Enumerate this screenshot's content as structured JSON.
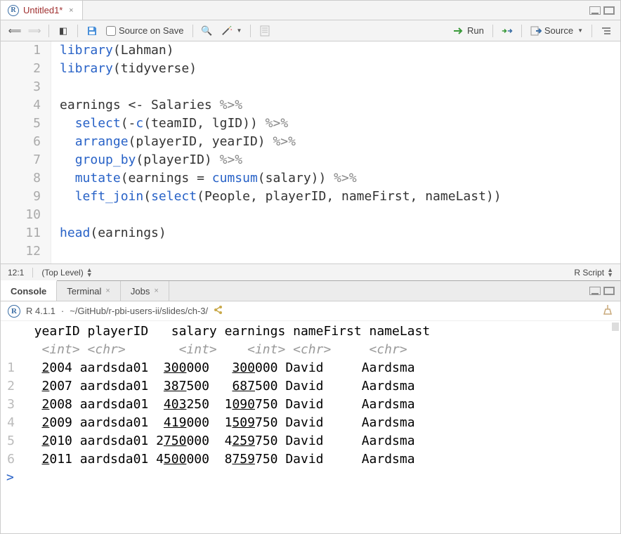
{
  "tab": {
    "title": "Untitled1*"
  },
  "toolbar": {
    "source_on_save": "Source on Save",
    "run": "Run",
    "source": "Source"
  },
  "editor": {
    "lines": [
      {
        "n": 1,
        "tokens": [
          {
            "t": "library",
            "c": "fn"
          },
          {
            "t": "(Lahman)",
            "c": ""
          }
        ]
      },
      {
        "n": 2,
        "tokens": [
          {
            "t": "library",
            "c": "fn"
          },
          {
            "t": "(tidyverse)",
            "c": ""
          }
        ]
      },
      {
        "n": 3,
        "tokens": []
      },
      {
        "n": 4,
        "tokens": [
          {
            "t": "earnings <- Salaries ",
            "c": ""
          },
          {
            "t": "%>%",
            "c": "op"
          }
        ]
      },
      {
        "n": 5,
        "tokens": [
          {
            "t": "  ",
            "c": ""
          },
          {
            "t": "select",
            "c": "fn"
          },
          {
            "t": "(-",
            "c": ""
          },
          {
            "t": "c",
            "c": "fn"
          },
          {
            "t": "(teamID, lgID)) ",
            "c": ""
          },
          {
            "t": "%>%",
            "c": "op"
          }
        ]
      },
      {
        "n": 6,
        "tokens": [
          {
            "t": "  ",
            "c": ""
          },
          {
            "t": "arrange",
            "c": "fn"
          },
          {
            "t": "(playerID, yearID) ",
            "c": ""
          },
          {
            "t": "%>%",
            "c": "op"
          }
        ]
      },
      {
        "n": 7,
        "tokens": [
          {
            "t": "  ",
            "c": ""
          },
          {
            "t": "group_by",
            "c": "fn"
          },
          {
            "t": "(playerID) ",
            "c": ""
          },
          {
            "t": "%>%",
            "c": "op"
          }
        ]
      },
      {
        "n": 8,
        "tokens": [
          {
            "t": "  ",
            "c": ""
          },
          {
            "t": "mutate",
            "c": "fn"
          },
          {
            "t": "(earnings = ",
            "c": ""
          },
          {
            "t": "cumsum",
            "c": "fn"
          },
          {
            "t": "(salary)) ",
            "c": ""
          },
          {
            "t": "%>%",
            "c": "op"
          }
        ]
      },
      {
        "n": 9,
        "tokens": [
          {
            "t": "  ",
            "c": ""
          },
          {
            "t": "left_join",
            "c": "fn"
          },
          {
            "t": "(",
            "c": ""
          },
          {
            "t": "select",
            "c": "fn"
          },
          {
            "t": "(People, playerID, nameFirst, nameLast))",
            "c": ""
          }
        ]
      },
      {
        "n": 10,
        "tokens": []
      },
      {
        "n": 11,
        "tokens": [
          {
            "t": "head",
            "c": "fn"
          },
          {
            "t": "(earnings)",
            "c": ""
          }
        ]
      },
      {
        "n": 12,
        "tokens": []
      }
    ]
  },
  "status": {
    "pos": "12:1",
    "scope": "(Top Level)",
    "lang": "R Script"
  },
  "console": {
    "tabs": [
      "Console",
      "Terminal",
      "Jobs"
    ],
    "version": "R 4.1.1",
    "wd": "~/GitHub/r-pbi-users-ii/slides/ch-3/",
    "header": "  yearID playerID   salary earnings nameFirst nameLast",
    "types": "   <int> <chr>       <int>    <int> <chr>     <chr>   ",
    "rows": [
      {
        "n": "1",
        "cells": [
          "   ",
          {
            "u": "2"
          },
          "004 aardsda01  ",
          {
            "u": "300"
          },
          "000   ",
          {
            "u": "300"
          },
          "000 David     Aardsma "
        ]
      },
      {
        "n": "2",
        "cells": [
          "   ",
          {
            "u": "2"
          },
          "007 aardsda01  ",
          {
            "u": "387"
          },
          "500   ",
          {
            "u": "687"
          },
          "500 David     Aardsma "
        ]
      },
      {
        "n": "3",
        "cells": [
          "   ",
          {
            "u": "2"
          },
          "008 aardsda01  ",
          {
            "u": "403"
          },
          "250  1",
          {
            "u": "090"
          },
          "750 David     Aardsma "
        ]
      },
      {
        "n": "4",
        "cells": [
          "   ",
          {
            "u": "2"
          },
          "009 aardsda01  ",
          {
            "u": "419"
          },
          "000  1",
          {
            "u": "509"
          },
          "750 David     Aardsma "
        ]
      },
      {
        "n": "5",
        "cells": [
          "   ",
          {
            "u": "2"
          },
          "010 aardsda01 2",
          {
            "u": "750"
          },
          "000  4",
          {
            "u": "259"
          },
          "750 David     Aardsma "
        ]
      },
      {
        "n": "6",
        "cells": [
          "   ",
          {
            "u": "2"
          },
          "011 aardsda01 4",
          {
            "u": "500"
          },
          "000  8",
          {
            "u": "759"
          },
          "750 David     Aardsma "
        ]
      }
    ],
    "prompt": "> "
  }
}
